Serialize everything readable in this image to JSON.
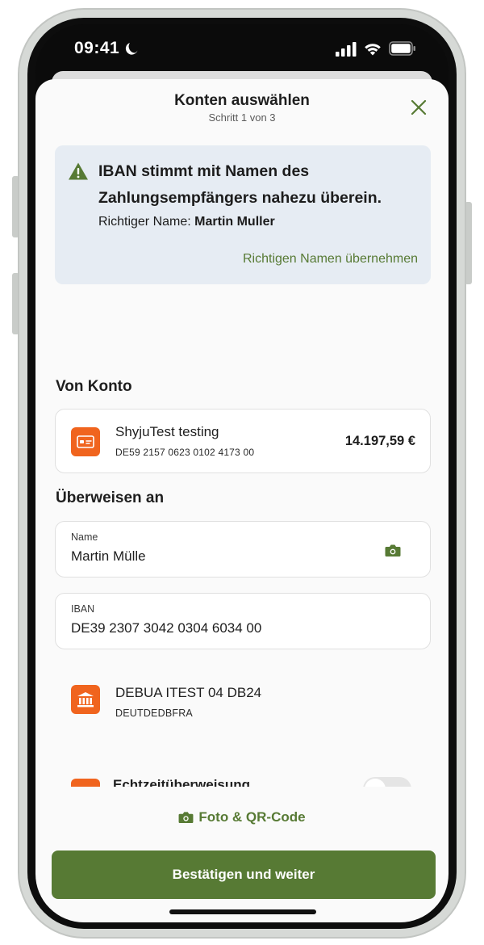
{
  "status": {
    "time": "09:41"
  },
  "header": {
    "title": "Konten auswählen",
    "step": "Schritt 1 von 3"
  },
  "warning": {
    "title": "IBAN stimmt mit Namen des Zahlungsempfängers nahezu überein.",
    "correct_name_label": "Richtiger Name:",
    "correct_name_value": "Martin Muller",
    "action_label": "Richtigen Namen übernehmen"
  },
  "from_account": {
    "section_label": "Von Konto",
    "name": "ShyjuTest testing",
    "iban": "DE59 2157 0623 0102 4173 00",
    "balance": "14.197,59 €"
  },
  "transfer_to": {
    "section_label": "Überweisen an",
    "name_field": {
      "label": "Name",
      "value": "Martin Mülle"
    },
    "iban_field": {
      "label": "IBAN",
      "value": "DE39 2307 3042 0304 6034 00"
    }
  },
  "bank": {
    "name": "DEBUA ITEST 04 DB24",
    "bic": "DEUTDEDBFRA"
  },
  "partial_row": {
    "text": "Echtzeitüberweisung"
  },
  "footer": {
    "photo_qr_label": "Foto & QR-Code",
    "confirm_label": "Bestätigen und weiter"
  },
  "colors": {
    "brand_green": "#577a34",
    "accent_orange": "#f0641e",
    "warning_bg": "#e6ecf3"
  },
  "icons": {
    "status": [
      "moon-icon",
      "signal-icon",
      "wifi-icon",
      "battery-icon"
    ],
    "header": "close-icon",
    "warning": "warning-triangle-icon",
    "account": "card-icon",
    "bank": "bank-icon",
    "camera": "camera-icon"
  }
}
